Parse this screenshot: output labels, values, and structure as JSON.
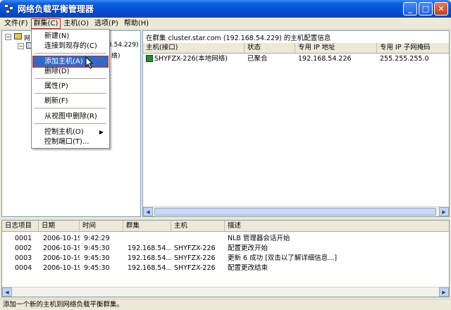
{
  "window": {
    "title": "网络负载平衡管理器",
    "minimize_label": "_",
    "maximize_label": "□",
    "close_label": "✕"
  },
  "menubar": {
    "items": [
      {
        "label": "文件(F)"
      },
      {
        "label": "群集(C)"
      },
      {
        "label": "主机(O)"
      },
      {
        "label": "选项(P)"
      },
      {
        "label": "帮助(H)"
      }
    ]
  },
  "tree": {
    "root_label": "网",
    "child_ip_fragment": "3.54.229)",
    "child_fragment2": "络)"
  },
  "cluster_menu": {
    "items": [
      {
        "label": "新建(N)"
      },
      {
        "label": "连接到现存的(C)"
      },
      {
        "label": "添加主机(A)"
      },
      {
        "label": "删除(D)"
      },
      {
        "label": "属性(P)"
      },
      {
        "label": "刷新(F)"
      },
      {
        "label": "从视图中删除(R)"
      },
      {
        "label": "控制主机(O)"
      },
      {
        "label": "控制端口(T)..."
      }
    ]
  },
  "details": {
    "info": "在群集 cluster.star.com (192.168.54.229) 的主机配置信息",
    "columns": [
      "主机(接口)",
      "状态",
      "专用 IP 地址",
      "专用 IP 子网掩码"
    ],
    "rows": [
      {
        "host": "SHYFZX-226(本地网络)",
        "status": "已聚合",
        "ip": "192.168.54.226",
        "mask": "255.255.255.0"
      }
    ]
  },
  "log": {
    "columns": [
      "日志项目",
      "日期",
      "时间",
      "群集",
      "主机",
      "描述"
    ],
    "rows": [
      {
        "id": "0001",
        "date": "2006-10-19",
        "time": "9:42:29",
        "cluster": "",
        "host": "",
        "desc": "NLB 管理器会话开始"
      },
      {
        "id": "0002",
        "date": "2006-10-19",
        "time": "9:45:30",
        "cluster": "192.168.54...",
        "host": "SHYFZX-226",
        "desc": "配置更改开始"
      },
      {
        "id": "0003",
        "date": "2006-10-19",
        "time": "9:45:30",
        "cluster": "192.168.54...",
        "host": "SHYFZX-226",
        "desc": "更新 6 成功 [双击以了解详细信息...]"
      },
      {
        "id": "0004",
        "date": "2006-10-19",
        "time": "9:45:30",
        "cluster": "192.168.54...",
        "host": "SHYFZX-226",
        "desc": "配置更改结束"
      }
    ]
  },
  "statusbar": {
    "text": "添加一个新的主机到网络负载平衡群集。"
  }
}
